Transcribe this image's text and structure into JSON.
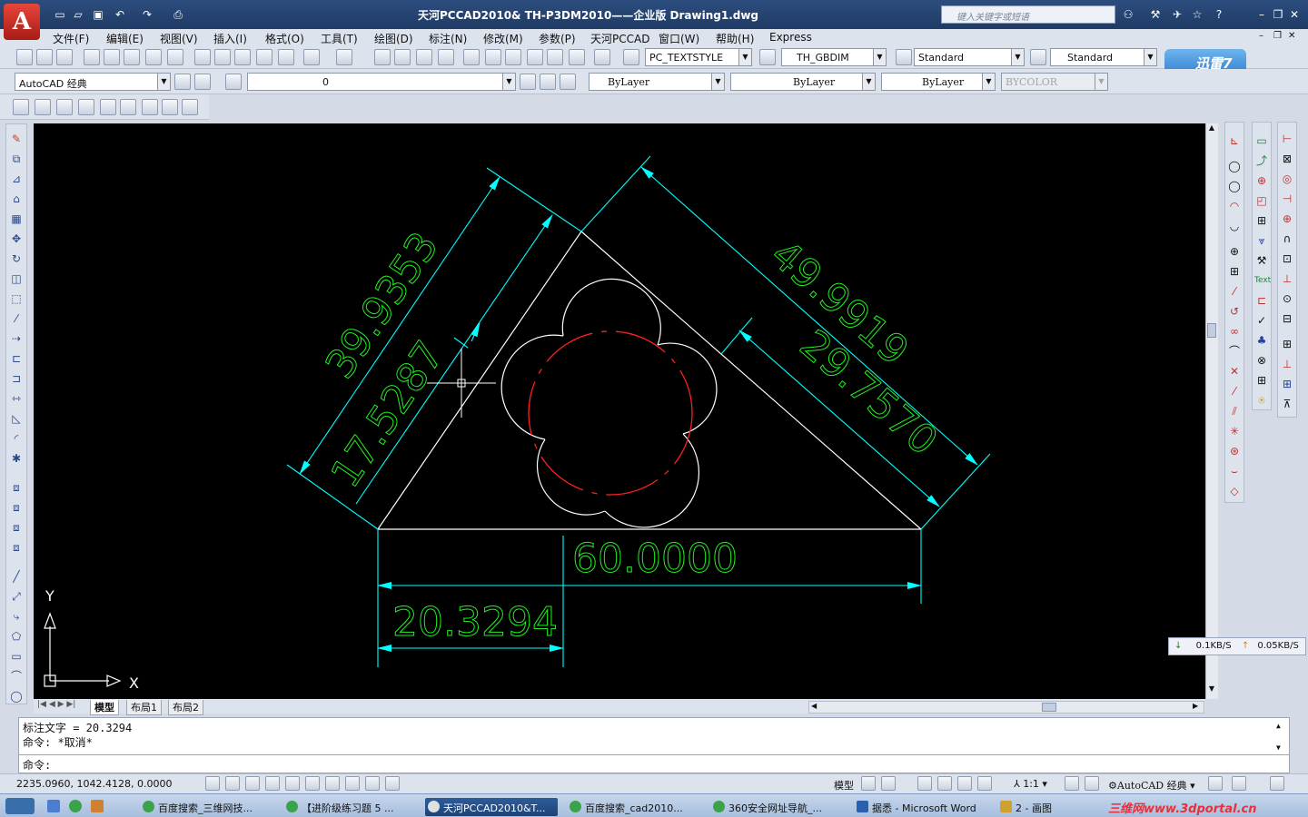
{
  "window": {
    "title": "天河PCCAD2010& TH-P3DM2010——企业版    Drawing1.dwg",
    "search_placeholder": "键入关键字或短语"
  },
  "menu": [
    "文件(F)",
    "编辑(E)",
    "视图(V)",
    "插入(I)",
    "格式(O)",
    "工具(T)",
    "绘图(D)",
    "标注(N)",
    "修改(M)",
    "参数(P)",
    "天河PCCAD",
    "窗口(W)",
    "帮助(H)",
    "Express"
  ],
  "toolbar": {
    "text_style": "PC_TEXTSTYLE",
    "dim_style": "TH_GBDIM",
    "table_style": "Standard",
    "multileader_style": "Standard",
    "workspace": "AutoCAD 经典",
    "layer": "0",
    "color": "ByLayer",
    "linetype": "ByLayer",
    "lineweight": "ByLayer",
    "plotstyle": "BYCOLOR"
  },
  "xunlei_badge": "迅雷7",
  "drawing": {
    "dim_39": "39.9353",
    "dim_17": "17.5287",
    "dim_49": "49.9919",
    "dim_29": "29.7570",
    "dim_60": "60.0000",
    "dim_20": "20.3294",
    "ucs_x": "X",
    "ucs_y": "Y",
    "colors": {
      "geometry": "#ffffff",
      "dimension": "#00ffff",
      "dimtext": "#00ff00",
      "center": "#ff0000"
    }
  },
  "network": {
    "down": "0.1KB/S",
    "up": "0.05KB/S"
  },
  "layout_tabs": [
    "模型",
    "布局1",
    "布局2"
  ],
  "command": {
    "line1": "标注文字 = 20.3294",
    "line2": "命令: *取消*",
    "prompt": "命令:"
  },
  "status": {
    "coords": "2235.0960,  1042.4128,  0.0000",
    "model": "模型",
    "scale": "1:1",
    "workspace": "AutoCAD 经典"
  },
  "taskbar": [
    "百度搜索_三维网技...",
    "【进阶级练习题 5 ...",
    "天河PCCAD2010&T...",
    "百度搜索_cad2010...",
    "360安全网址导航_...",
    "据悉 - Microsoft Word",
    "2 - 画图"
  ],
  "watermark": "三维网www.3dportal.cn"
}
